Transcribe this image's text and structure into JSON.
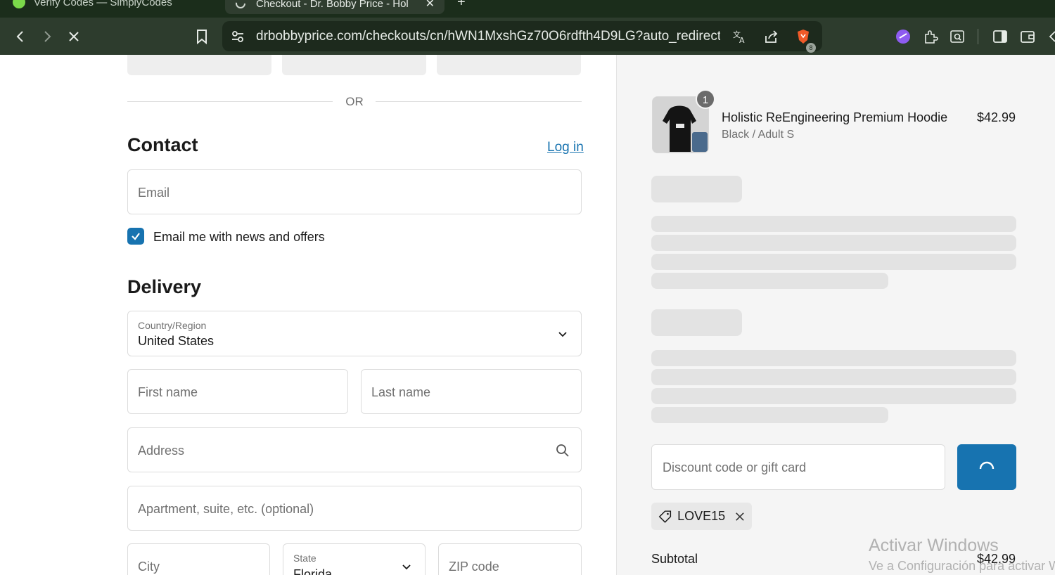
{
  "browser": {
    "inactive_tab_title": "Verify Codes — SimplyCodes",
    "active_tab_title": "Checkout - Dr. Bobby Price - Hol",
    "url": "drbobbyprice.com/checkouts/cn/hWN1MxshGz70O6rdfth4D9LG?auto_redirect=f...",
    "extension_badge_count": "8"
  },
  "checkout": {
    "or_divider": "OR",
    "contact_heading": "Contact",
    "login_link": "Log in",
    "email_placeholder": "Email",
    "newsletter_label": "Email me with news and offers",
    "newsletter_checked": true,
    "delivery_heading": "Delivery",
    "country_label": "Country/Region",
    "country_value": "United States",
    "first_name_placeholder": "First name",
    "last_name_placeholder": "Last name",
    "address_placeholder": "Address",
    "apartment_placeholder": "Apartment, suite, etc. (optional)",
    "city_placeholder": "City",
    "state_label": "State",
    "state_value": "Florida",
    "zip_placeholder": "ZIP code"
  },
  "summary": {
    "item": {
      "quantity": "1",
      "name": "Holistic ReEngineering Premium Hoodie",
      "variant": "Black / Adult S",
      "price": "$42.99"
    },
    "discount_placeholder": "Discount code or gift card",
    "applied_code": "LOVE15",
    "subtotal_label": "Subtotal",
    "subtotal_value": "$42.99"
  },
  "watermark": {
    "line1": "Activar Windows",
    "line2": "Ve a Configuración para activar W"
  },
  "colors": {
    "accent": "#1773b0",
    "toolbar": "#2d3c2d",
    "tabstrip": "#1b2d1b"
  }
}
